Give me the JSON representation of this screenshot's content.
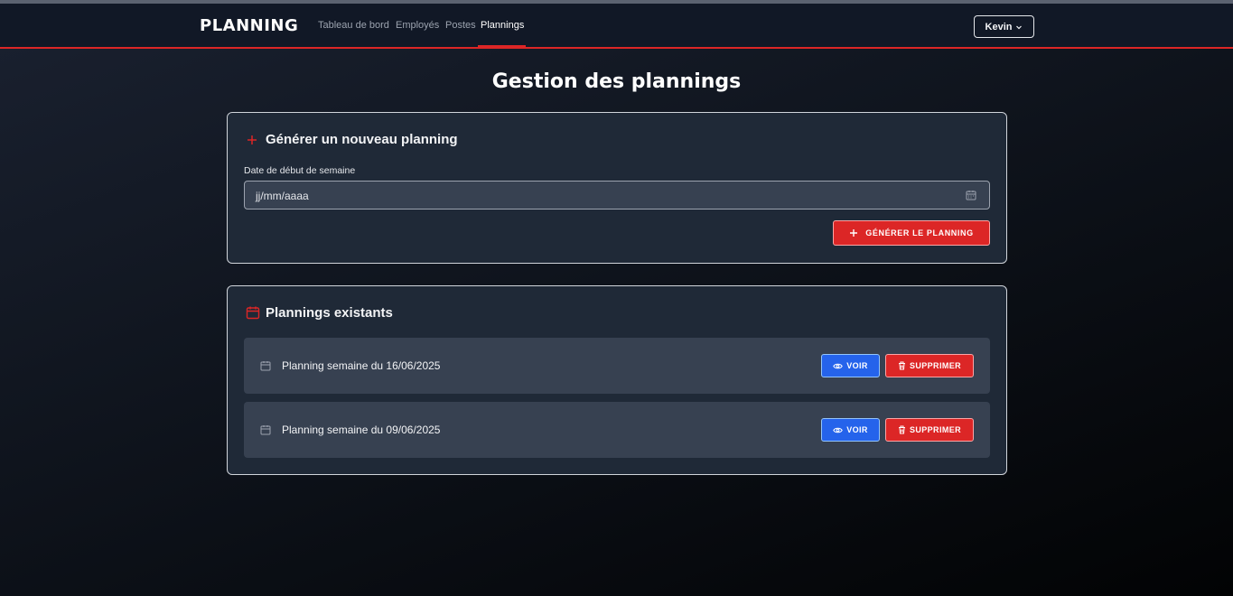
{
  "navbar": {
    "brand": "PLANNING",
    "links": [
      "Tableau de bord",
      "Employés",
      "Postes",
      "Plannings"
    ],
    "active": "Plannings",
    "user": "Kevin"
  },
  "page": {
    "title": "Gestion des plannings"
  },
  "generate_card": {
    "title": "Générer un nouveau planning",
    "date_label": "Date de début de semaine",
    "date_placeholder": "jj/mm/aaaa",
    "button_label": "GÉNÉRER LE PLANNING"
  },
  "existing_card": {
    "title": "Plannings existants",
    "items": [
      {
        "label": "Planning semaine du 16/06/2025",
        "view_label": "VOIR",
        "delete_label": "SUPPRIMER"
      },
      {
        "label": "Planning semaine du 09/06/2025",
        "view_label": "VOIR",
        "delete_label": "SUPPRIMER"
      }
    ]
  },
  "colors": {
    "accent": "#dc2626",
    "view": "#2563eb",
    "card": "#1f2937",
    "nav": "#111826"
  }
}
